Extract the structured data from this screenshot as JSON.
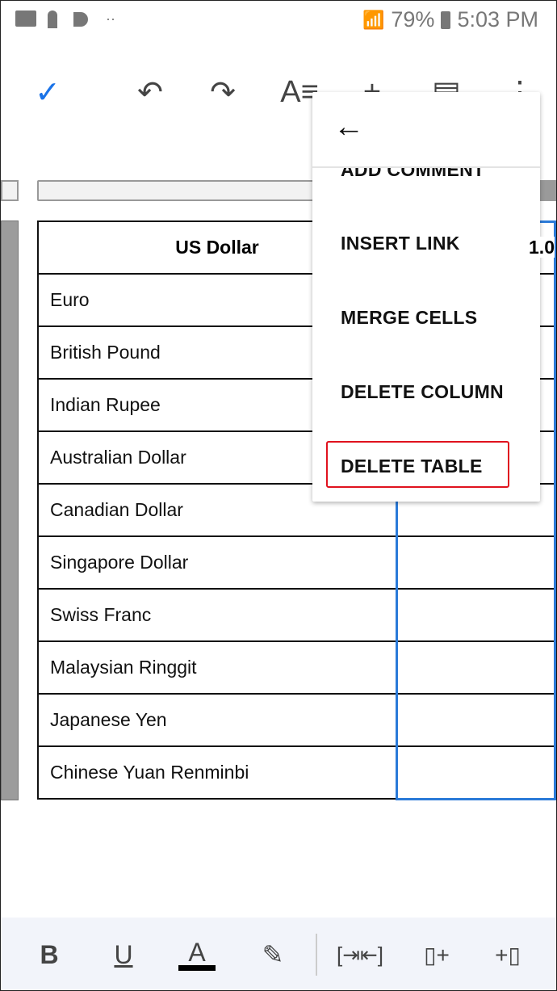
{
  "status": {
    "battery": "79%",
    "time": "5:03 PM"
  },
  "toolbar": {
    "icons": [
      "check-icon",
      "undo-icon",
      "redo-icon",
      "text-format-icon",
      "insert-plus-icon",
      "comment-list-icon",
      "more-vert-icon"
    ],
    "accent": "#1a73e8"
  },
  "table": {
    "header": [
      "US Dollar",
      "1.0"
    ],
    "rows": [
      "Euro",
      "British Pound",
      "Indian Rupee",
      "Australian Dollar",
      "Canadian Dollar",
      "Singapore Dollar",
      "Swiss Franc",
      "Malaysian Ringgit",
      "Japanese Yen",
      "Chinese Yuan Renminbi"
    ]
  },
  "menu": {
    "items": [
      "ADD COMMENT",
      "INSERT LINK",
      "MERGE CELLS",
      "DELETE COLUMN",
      "DELETE TABLE"
    ],
    "highlight_color": "#e0121e"
  },
  "bottom": {
    "bold": "B",
    "underline": "U",
    "text_color": "A"
  }
}
